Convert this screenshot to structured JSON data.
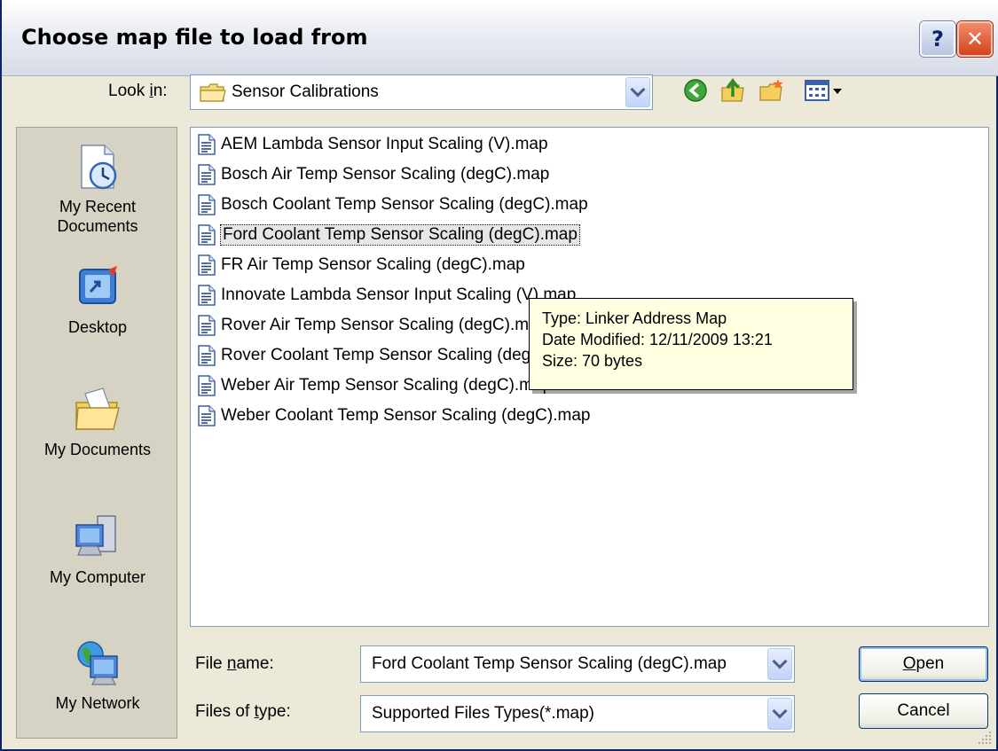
{
  "window": {
    "title": "Choose map file to load from",
    "help_label": "?",
    "close_label": "✕"
  },
  "lookin": {
    "label_pre": "Look ",
    "label_key": "i",
    "label_post": "n:",
    "value": "Sensor Calibrations"
  },
  "places": [
    {
      "label": "My Recent Documents",
      "icon": "recent-documents-icon"
    },
    {
      "label": "Desktop",
      "icon": "desktop-icon"
    },
    {
      "label": "My Documents",
      "icon": "my-documents-icon"
    },
    {
      "label": "My Computer",
      "icon": "my-computer-icon"
    },
    {
      "label": "My Network",
      "icon": "my-network-icon"
    }
  ],
  "files": [
    "AEM Lambda Sensor Input Scaling (V).map",
    "Bosch Air Temp Sensor Scaling (degC).map",
    "Bosch Coolant Temp Sensor Scaling (degC).map",
    "Ford Coolant Temp Sensor Scaling (degC).map",
    "FR Air Temp Sensor Scaling (degC).map",
    "Innovate Lambda Sensor Input Scaling (V).map",
    "Rover Air Temp Sensor Scaling (degC).map",
    "Rover Coolant Temp Sensor Scaling (degC).map",
    "Weber Air Temp Sensor Scaling (degC).map",
    "Weber Coolant Temp Sensor Scaling (degC).map"
  ],
  "selected_file_index": 3,
  "tooltip": {
    "type": "Type: Linker Address Map",
    "date": "Date Modified: 12/11/2009 13:21",
    "size": "Size: 70 bytes"
  },
  "filename": {
    "label_pre": "File ",
    "label_key": "n",
    "label_post": "ame:",
    "value": "Ford Coolant Temp Sensor Scaling (degC).map"
  },
  "filetype": {
    "label_pre": "Files of ",
    "label_key": "t",
    "label_post": "ype:",
    "value": "Supported Files Types(*.map)"
  },
  "buttons": {
    "open_key": "O",
    "open_rest": "pen",
    "cancel": "Cancel"
  },
  "colors": {
    "title_bar": "#e9ecf3",
    "close_button": "#d4421b",
    "tooltip_bg": "#ffffe1",
    "places_bar": "#d6d3c5"
  }
}
